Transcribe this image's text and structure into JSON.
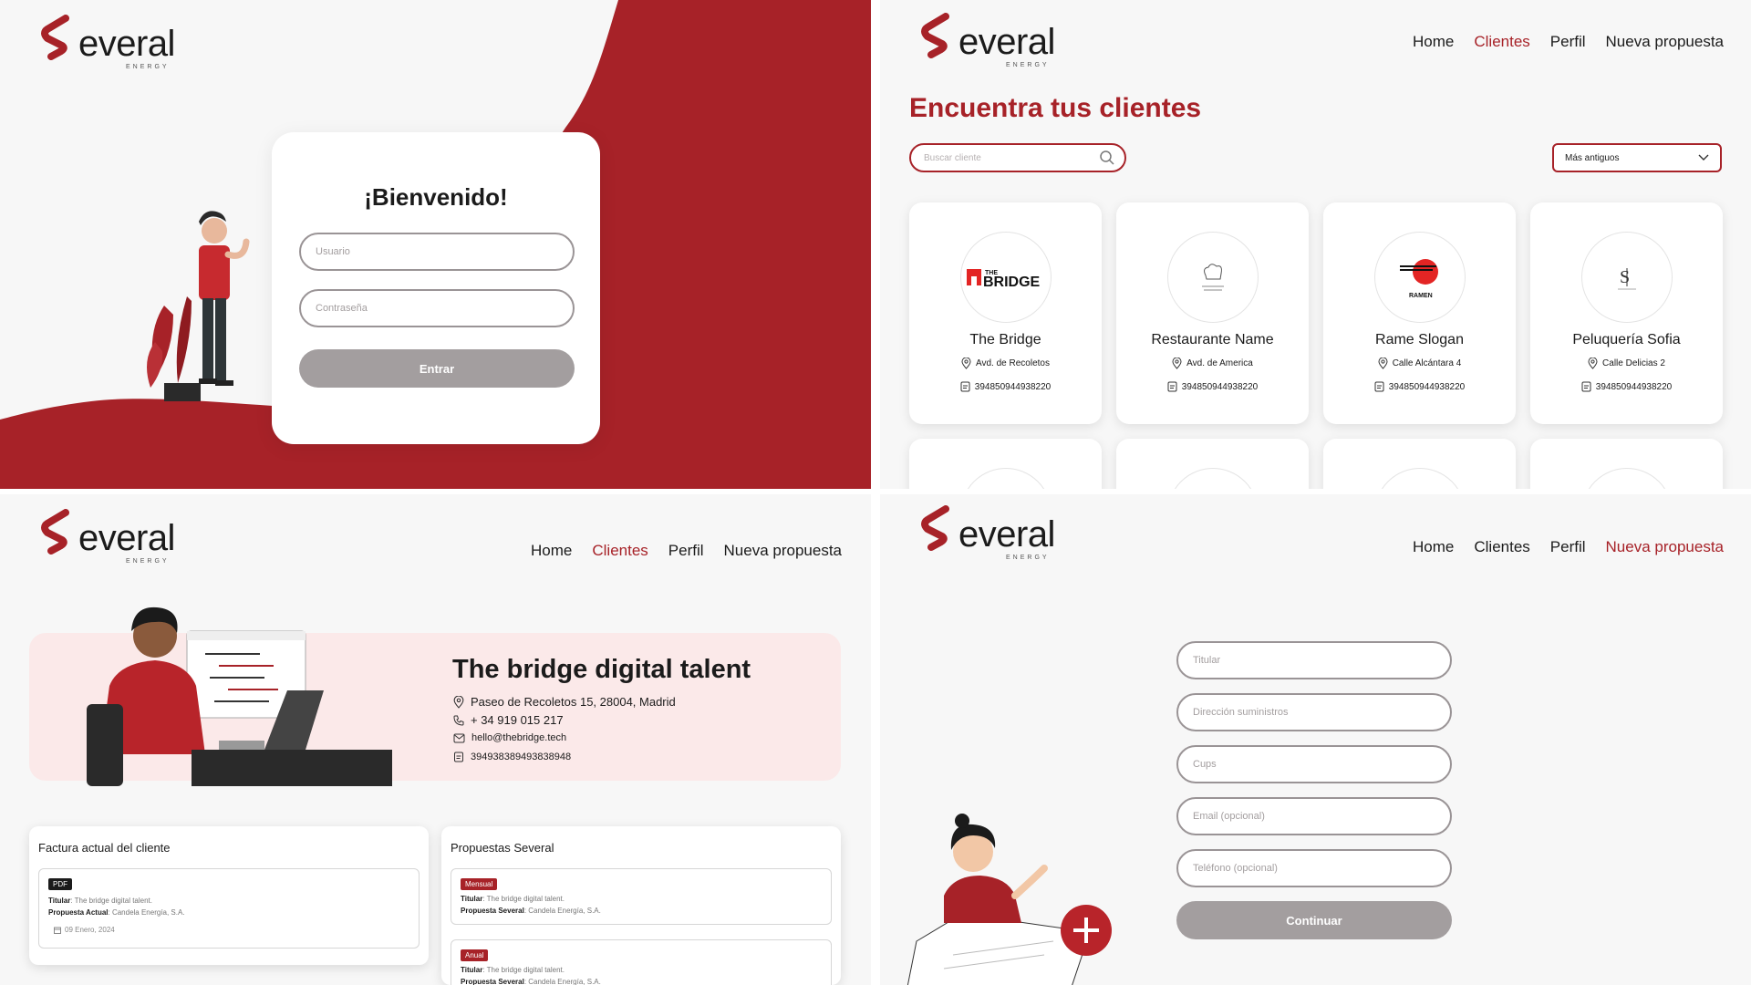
{
  "brand": {
    "word": "everal",
    "sub": "ENERGY",
    "accent": "#a72228",
    "grey": "#a39e9f"
  },
  "nav": {
    "home": "Home",
    "clients": "Clientes",
    "profile": "Perfil",
    "new_proposal": "Nueva propuesta"
  },
  "login": {
    "title": "¡Bienvenido!",
    "user_placeholder": "Usuario",
    "pass_placeholder": "Contraseña",
    "submit": "Entrar"
  },
  "clients_page": {
    "title": "Encuentra tus clientes",
    "search_placeholder": "Buscar cliente",
    "sort_value": "Más antiguos",
    "clients": [
      {
        "name": "The Bridge",
        "address": "Avd. de Recoletos",
        "id": "394850944938220",
        "logo": "the-bridge-logo"
      },
      {
        "name": "Restaurante Name",
        "address": "Avd. de America",
        "id": "394850944938220",
        "logo": "restaurant-logo"
      },
      {
        "name": "Rame Slogan",
        "address": "Calle Alcántara 4",
        "id": "394850944938220",
        "logo": "ramen-logo"
      },
      {
        "name": "Peluquería Sofia",
        "address": "Calle Delicias 2",
        "id": "394850944938220",
        "logo": "salon-logo"
      }
    ]
  },
  "client_detail": {
    "name": "The bridge digital talent",
    "address": "Paseo de Recoletos 15, 28004, Madrid",
    "phone": "+ 34 919 015 217",
    "email": "hello@thebridge.tech",
    "id": "394938389493838948",
    "invoice_panel": {
      "title": "Factura actual del cliente",
      "tag": "PDF",
      "holder_label": "Titular",
      "holder": ": The bridge digital talent.",
      "current_label": "Propuesta Actual",
      "current": ": Candela Energía, S.A.",
      "date": "09 Enero, 2024"
    },
    "proposals_panel": {
      "title": "Propuestas Several",
      "items": [
        {
          "tag": "Mensual",
          "holder_label": "Titular",
          "holder": ": The bridge digital talent.",
          "proposal_label": "Propuesta Several",
          "proposal": ": Candela Energía, S.A."
        },
        {
          "tag": "Anual",
          "holder_label": "Titular",
          "holder": ": The bridge digital talent.",
          "proposal_label": "Propuesta Several",
          "proposal": ": Candela Energía, S.A."
        }
      ]
    }
  },
  "proposal_form": {
    "holder": "Titular",
    "supply_address": "Dirección suministros",
    "cups": "Cups",
    "email": "Email (opcional)",
    "phone": "Teléfono (opcional)",
    "submit": "Continuar"
  }
}
